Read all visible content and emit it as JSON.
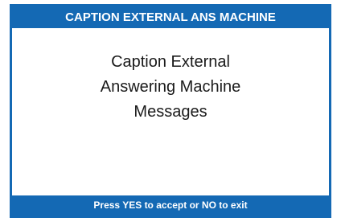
{
  "header": {
    "title": "CAPTION EXTERNAL ANS MACHINE"
  },
  "main": {
    "message_lines": [
      "Caption External",
      "Answering Machine",
      "Messages"
    ]
  },
  "footer": {
    "prompt": "Press YES to accept or NO to exit"
  },
  "colors": {
    "accent": "#1469b4",
    "background": "#ffffff",
    "text": "#1a1a1a"
  }
}
